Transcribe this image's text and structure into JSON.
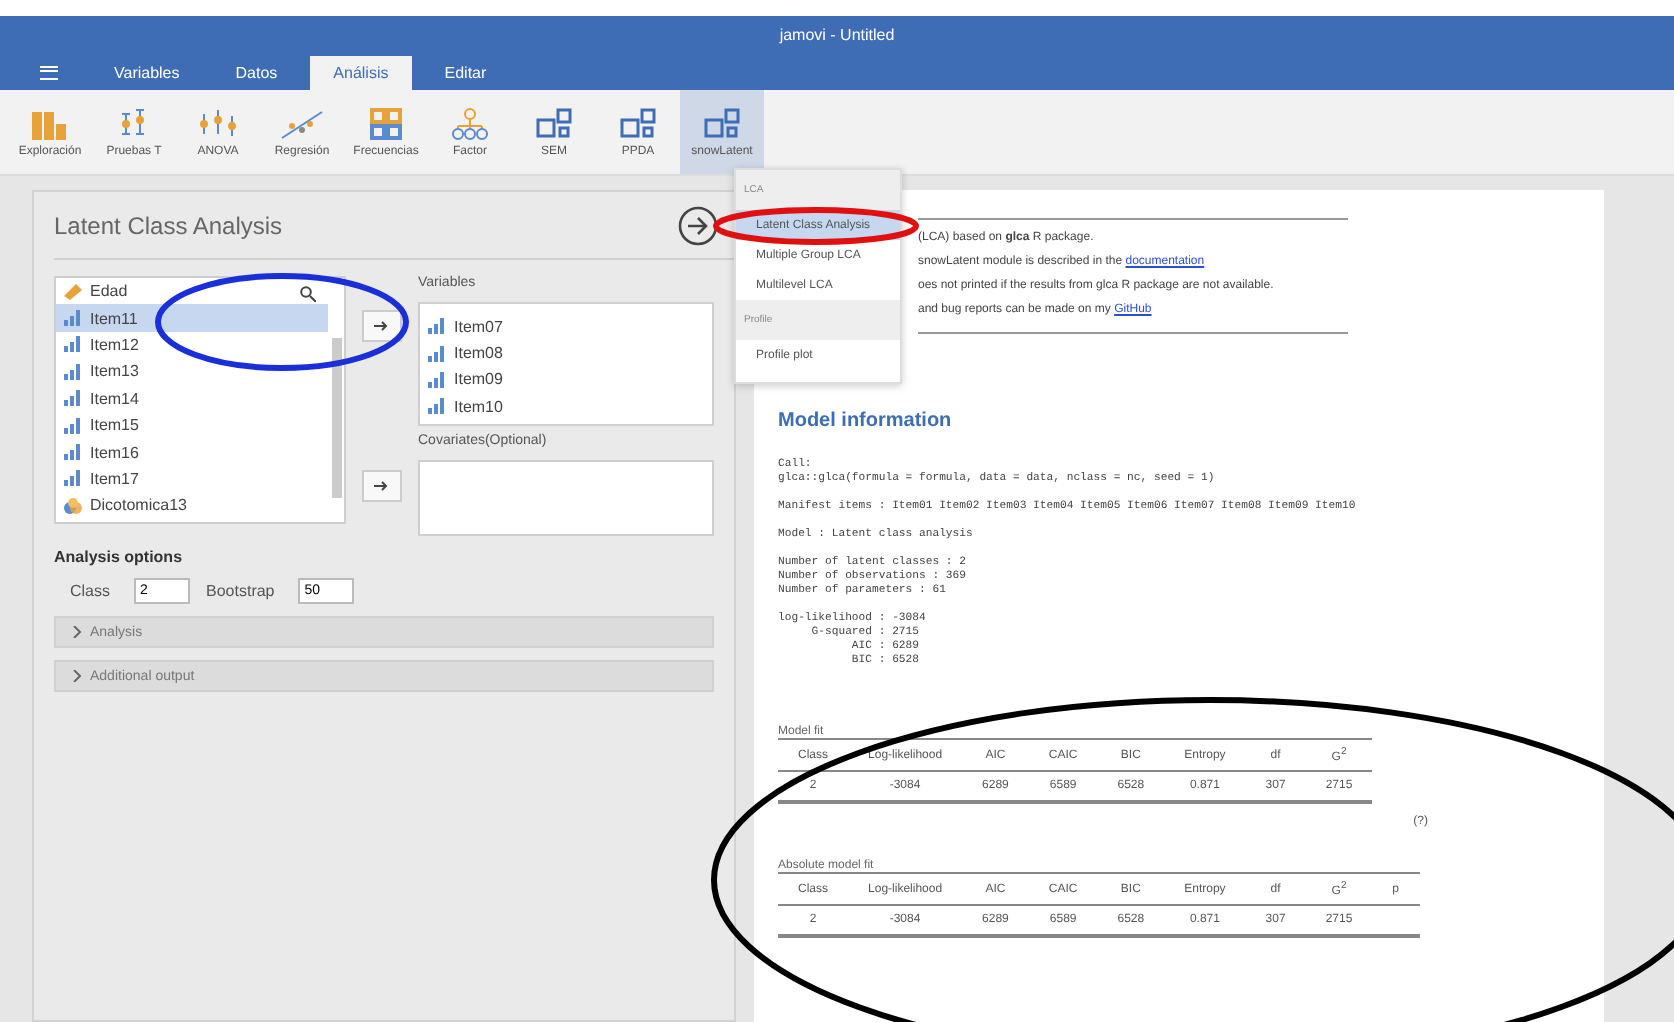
{
  "window": {
    "title": "jamovi - Untitled"
  },
  "tabs": [
    {
      "label": "Variables",
      "selected": false
    },
    {
      "label": "Datos",
      "selected": false
    },
    {
      "label": "Análisis",
      "selected": true
    },
    {
      "label": "Editar",
      "selected": false
    }
  ],
  "ribbon": [
    {
      "label": "Exploración",
      "kind": "bars",
      "selected": false
    },
    {
      "label": "Pruebas T",
      "kind": "ttest",
      "selected": false
    },
    {
      "label": "ANOVA",
      "kind": "anova",
      "selected": false
    },
    {
      "label": "Regresión",
      "kind": "regression",
      "selected": false
    },
    {
      "label": "Frecuencias",
      "kind": "grid",
      "selected": false
    },
    {
      "label": "Factor",
      "kind": "tree",
      "selected": false
    },
    {
      "label": "SEM",
      "kind": "boxes",
      "selected": false
    },
    {
      "label": "PPDA",
      "kind": "boxes",
      "selected": false
    },
    {
      "label": "snowLatent",
      "kind": "boxes",
      "selected": true
    }
  ],
  "menu": {
    "groups": [
      {
        "header": "LCA",
        "items": [
          {
            "label": "Latent Class Analysis",
            "selected": true
          },
          {
            "label": "Multiple Group LCA",
            "selected": false
          },
          {
            "label": "Multilevel LCA",
            "selected": false
          }
        ]
      },
      {
        "header": "Profile",
        "items": [
          {
            "label": "Profile plot",
            "selected": false
          }
        ]
      }
    ]
  },
  "analysis": {
    "title": "Latent Class Analysis",
    "source_variables": [
      {
        "name": "Edad",
        "kind": "continuous",
        "selected": false
      },
      {
        "name": "Item11",
        "kind": "ordinal",
        "selected": true
      },
      {
        "name": "Item12",
        "kind": "ordinal",
        "selected": false
      },
      {
        "name": "Item13",
        "kind": "ordinal",
        "selected": false
      },
      {
        "name": "Item14",
        "kind": "ordinal",
        "selected": false
      },
      {
        "name": "Item15",
        "kind": "ordinal",
        "selected": false
      },
      {
        "name": "Item16",
        "kind": "ordinal",
        "selected": false
      },
      {
        "name": "Item17",
        "kind": "ordinal",
        "selected": false
      },
      {
        "name": "Dicotomica13",
        "kind": "nominal",
        "selected": false
      }
    ],
    "variables": {
      "label": "Variables",
      "items": [
        {
          "name": "Item07",
          "kind": "ordinal"
        },
        {
          "name": "Item08",
          "kind": "ordinal"
        },
        {
          "name": "Item09",
          "kind": "ordinal"
        },
        {
          "name": "Item10",
          "kind": "ordinal"
        }
      ]
    },
    "covariates": {
      "label": "Covariates(Optional)"
    },
    "options_heading": "Analysis options",
    "options": [
      {
        "label": "Class",
        "value": "2"
      },
      {
        "label": "Bootstrap",
        "value": "50"
      }
    ],
    "sections": [
      {
        "label": "Analysis",
        "expanded": false
      },
      {
        "label": "Additional output",
        "expanded": false
      }
    ]
  },
  "results": {
    "intro": [
      "(LCA) based on **glca** R package.",
      {
        "text": "snowLatent module is described in the ",
        "link": "documentation"
      },
      "oes not printed if the results from glca R package are not available.",
      {
        "text": "and bug reports can be made on my ",
        "link": "GitHub"
      }
    ],
    "heading": "Model information",
    "output": "Call:\nglca::glca(formula = formula, data = data, nclass = nc, seed = 1)\n\nManifest items : Item01 Item02 Item03 Item04 Item05 Item06 Item07 Item08 Item09 Item10\n\nModel : Latent class analysis\n\nNumber of latent classes : 2\nNumber of observations : 369\nNumber of parameters : 61\n\nlog-likelihood : -3084\n     G-squared : 2715\n           AIC : 6289\n           BIC : 6528",
    "tables": [
      {
        "title": "Model fit",
        "columns": [
          "Class",
          "Log-likelihood",
          "AIC",
          "CAIC",
          "BIC",
          "Entropy",
          "df",
          "G$^{2}$"
        ],
        "rows": [
          [
            "2",
            "-3084",
            "6289",
            "6589",
            "6528",
            "0.871",
            "307",
            "2715"
          ]
        ],
        "footnote": "(?)"
      },
      {
        "title": "Absolute model fit",
        "columns": [
          "Class",
          "Log-likelihood",
          "AIC",
          "CAIC",
          "BIC",
          "Entropy",
          "df",
          "G$^{2}$",
          "p"
        ],
        "rows": [
          [
            "2",
            "-3084",
            "6289",
            "6589",
            "6528",
            "0.871",
            "307",
            "2715"
          ]
        ]
      }
    ]
  }
}
